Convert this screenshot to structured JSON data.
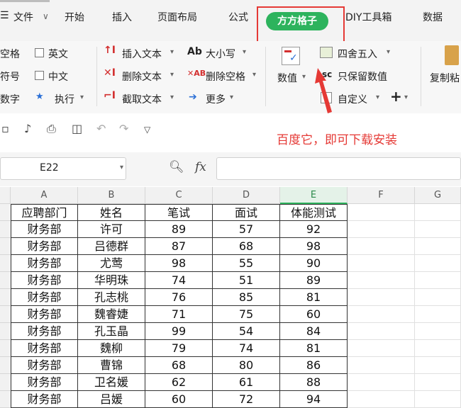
{
  "menu": {
    "file": "文件",
    "tabs": [
      "开始",
      "插入",
      "页面布局",
      "公式",
      "方方格子",
      "DIY工具箱",
      "数据"
    ]
  },
  "ribbon": {
    "col1": [
      "空格",
      "符号",
      "数字"
    ],
    "col2": [
      "英文",
      "中文",
      "执行"
    ],
    "col3": [
      "插入文本",
      "删除文本",
      "截取文本"
    ],
    "col4": [
      "大小写",
      "删除空格",
      "更多"
    ],
    "numeric": "数值",
    "round": "四舍五入",
    "keep_number": "只保留数值",
    "custom": "自定义",
    "copy": "复制粘"
  },
  "annotation": "百度它，即可下载安装",
  "formula_bar": {
    "cell_ref": "E22",
    "fx": "fx"
  },
  "columns": [
    "A",
    "B",
    "C",
    "D",
    "E",
    "F",
    "G"
  ],
  "headers": [
    "应聘部门",
    "姓名",
    "笔试",
    "面试",
    "体能测试"
  ],
  "rows": [
    [
      "财务部",
      "许可",
      "89",
      "57",
      "92"
    ],
    [
      "财务部",
      "吕德群",
      "87",
      "68",
      "98"
    ],
    [
      "财务部",
      "尤莺",
      "98",
      "55",
      "90"
    ],
    [
      "财务部",
      "华明珠",
      "74",
      "51",
      "89"
    ],
    [
      "财务部",
      "孔志桃",
      "76",
      "85",
      "81"
    ],
    [
      "财务部",
      "魏睿婕",
      "71",
      "75",
      "60"
    ],
    [
      "财务部",
      "孔玉晶",
      "99",
      "54",
      "84"
    ],
    [
      "财务部",
      "魏柳",
      "79",
      "74",
      "81"
    ],
    [
      "财务部",
      "曹锦",
      "68",
      "80",
      "86"
    ],
    [
      "财务部",
      "卫名媛",
      "62",
      "61",
      "88"
    ],
    [
      "财务部",
      "吕媛",
      "60",
      "72",
      "94"
    ]
  ]
}
